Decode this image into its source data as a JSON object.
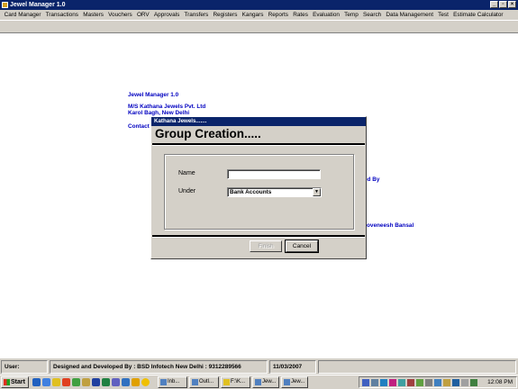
{
  "window": {
    "title": "Jewel Manager 1.0"
  },
  "menu": [
    "Card Manager",
    "Transactions",
    "Masters",
    "Vouchers",
    "ORV",
    "Approvals",
    "Transfers",
    "Registers",
    "Kangars",
    "Reports",
    "Rates",
    "Evaluation",
    "Temp",
    "Search",
    "Data Management",
    "Test",
    "Estimate Calculator"
  ],
  "background": {
    "app_name": "Jewel Manager 1.0",
    "company": "M/S Kathana Jewels Pvt. Ltd",
    "address": "Karol Bagh, New Delhi",
    "contact_partial": "Contact",
    "designed_partial": "ed By",
    "person_partial": "oveneesh Bansal"
  },
  "dialog": {
    "title": "Kathana Jewels.......",
    "heading": "Group Creation.....",
    "name_label": "Name",
    "name_value": "",
    "under_label": "Under",
    "under_value": "Bank Accounts",
    "finish_label": "Finish",
    "cancel_label": "Cancel"
  },
  "status": {
    "user_label": "User:",
    "designed_by": "Designed and Developed By : BSD Infotech New Delhi : 9312289566",
    "date": "11/03/2007"
  },
  "taskbar": {
    "start_label": "Start",
    "tasks": [
      "Inb...",
      "Outl...",
      "F:\\K...",
      "Jew...",
      "Jew..."
    ],
    "clock": "12:08 PM"
  },
  "colors": {
    "title_bar": "#0a246a",
    "chrome": "#d4d0c8",
    "background_text": "#0000c0"
  }
}
